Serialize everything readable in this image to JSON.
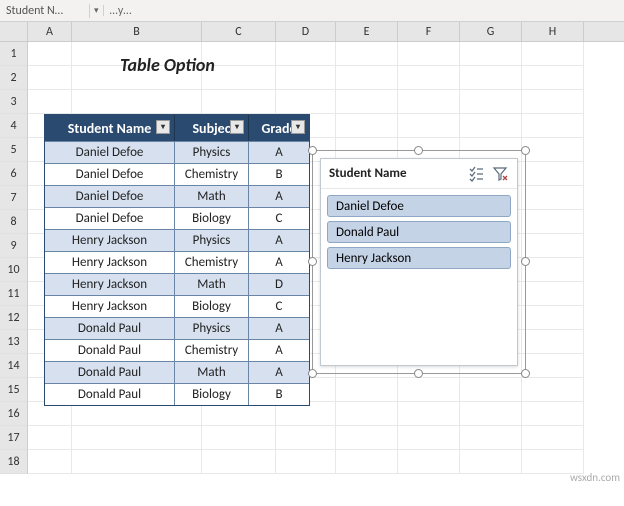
{
  "top": {
    "name_box": "Student N…",
    "fx_box": "…y…"
  },
  "columns": [
    "A",
    "B",
    "C",
    "D",
    "E",
    "F",
    "G",
    "H"
  ],
  "row_numbers": [
    1,
    2,
    3,
    4,
    5,
    6,
    7,
    8,
    9,
    10,
    11,
    12,
    13,
    14,
    15,
    16,
    17,
    18
  ],
  "title": "Table Option",
  "table": {
    "headers": {
      "name": "Student Name",
      "subject": "Subjec",
      "grade": "Grade"
    },
    "rows": [
      {
        "name": "Daniel Defoe",
        "subject": "Physics",
        "grade": "A"
      },
      {
        "name": "Daniel Defoe",
        "subject": "Chemistry",
        "grade": "B"
      },
      {
        "name": "Daniel Defoe",
        "subject": "Math",
        "grade": "A"
      },
      {
        "name": "Daniel Defoe",
        "subject": "Biology",
        "grade": "C"
      },
      {
        "name": "Henry Jackson",
        "subject": "Physics",
        "grade": "A"
      },
      {
        "name": "Henry Jackson",
        "subject": "Chemistry",
        "grade": "A"
      },
      {
        "name": "Henry Jackson",
        "subject": "Math",
        "grade": "D"
      },
      {
        "name": "Henry Jackson",
        "subject": "Biology",
        "grade": "C"
      },
      {
        "name": "Donald Paul",
        "subject": "Physics",
        "grade": "A"
      },
      {
        "name": "Donald Paul",
        "subject": "Chemistry",
        "grade": "A"
      },
      {
        "name": "Donald Paul",
        "subject": "Math",
        "grade": "A"
      },
      {
        "name": "Donald Paul",
        "subject": "Biology",
        "grade": "B"
      }
    ]
  },
  "slicer": {
    "title": "Student Name",
    "items": [
      "Daniel Defoe",
      "Donald Paul",
      "Henry Jackson"
    ]
  },
  "watermark": "wsxdn.com"
}
